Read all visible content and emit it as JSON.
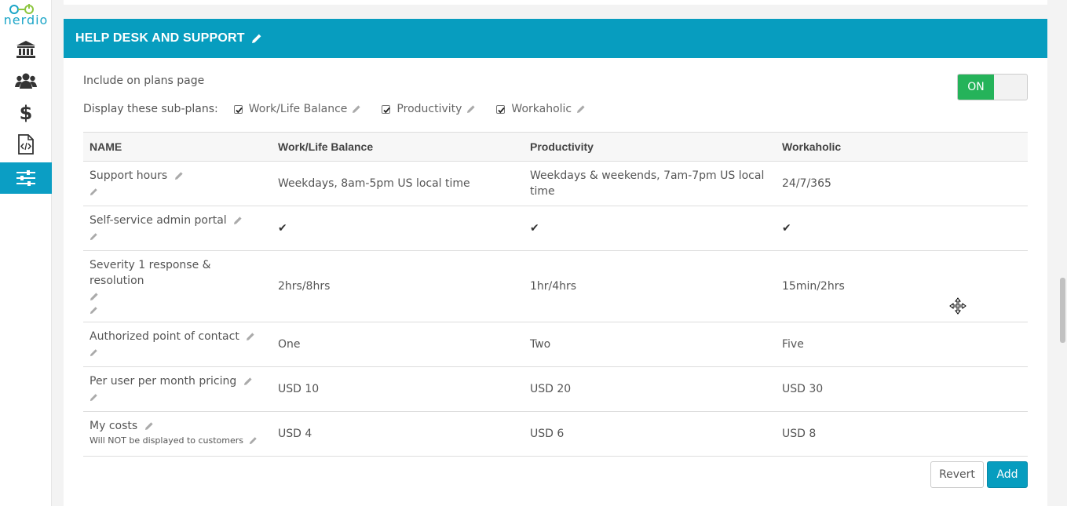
{
  "brand": {
    "logo_text": "nerdio"
  },
  "sidebar": {
    "items": [
      {
        "icon": "bank-icon"
      },
      {
        "icon": "users-icon"
      },
      {
        "icon": "dollar-icon",
        "glyph": "$"
      },
      {
        "icon": "code-file-icon"
      },
      {
        "icon": "sliders-icon",
        "active": true
      }
    ]
  },
  "section": {
    "title": "HELP DESK AND SUPPORT",
    "include_label": "Include on plans page",
    "toggle_label": "ON",
    "subplans_label": "Display these sub-plans:",
    "subplans": [
      {
        "label": "Work/Life Balance",
        "checked": true
      },
      {
        "label": "Productivity",
        "checked": true
      },
      {
        "label": "Workaholic",
        "checked": true
      }
    ]
  },
  "table": {
    "headers": [
      "NAME",
      "Work/Life Balance",
      "Productivity",
      "Workaholic"
    ],
    "rows": [
      {
        "name": "Support hours",
        "values": [
          "Weekdays, 8am-5pm US local time",
          "Weekdays & weekends, 7am-7pm US local time",
          "24/7/365"
        ]
      },
      {
        "name": "Self-service admin portal",
        "values": [
          "✔",
          "✔",
          "✔"
        ]
      },
      {
        "name": "Severity 1 response & resolution",
        "values": [
          "2hrs/8hrs",
          "1hr/4hrs",
          "15min/2hrs"
        ]
      },
      {
        "name": "Authorized point of contact",
        "values": [
          "One",
          "Two",
          "Five"
        ]
      },
      {
        "name": "Per user per month pricing",
        "values": [
          "USD 10",
          "USD 20",
          "USD 30"
        ]
      },
      {
        "name": "My costs",
        "note": "Will NOT be displayed to customers",
        "values": [
          "USD 4",
          "USD 6",
          "USD 8"
        ]
      }
    ]
  },
  "actions": {
    "revert_label": "Revert",
    "add_label": "Add"
  },
  "colors": {
    "accent": "#079dbf",
    "toggle_on": "#25b35a"
  }
}
